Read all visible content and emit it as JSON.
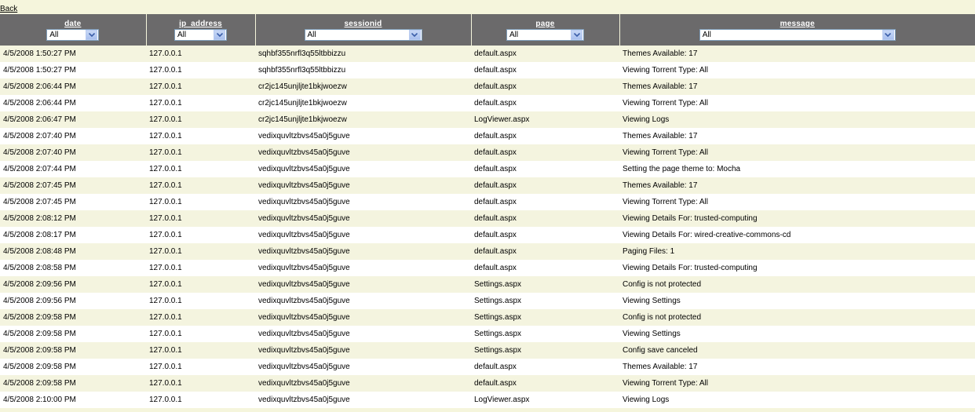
{
  "back_label": "Back",
  "columns": [
    {
      "title": "date",
      "filter": "All"
    },
    {
      "title": "ip_address",
      "filter": "All"
    },
    {
      "title": "sessionid",
      "filter": "All"
    },
    {
      "title": "page",
      "filter": "All"
    },
    {
      "title": "message",
      "filter": "All"
    }
  ],
  "rows": [
    [
      "4/5/2008 1:50:27 PM",
      "127.0.0.1",
      "sqhbf355nrfl3q55ltbbizzu",
      "default.aspx",
      "Themes Available: 17"
    ],
    [
      "4/5/2008 1:50:27 PM",
      "127.0.0.1",
      "sqhbf355nrfl3q55ltbbizzu",
      "default.aspx",
      "Viewing Torrent Type: All"
    ],
    [
      "4/5/2008 2:06:44 PM",
      "127.0.0.1",
      "cr2jc145unjljte1bkjwoezw",
      "default.aspx",
      "Themes Available: 17"
    ],
    [
      "4/5/2008 2:06:44 PM",
      "127.0.0.1",
      "cr2jc145unjljte1bkjwoezw",
      "default.aspx",
      "Viewing Torrent Type: All"
    ],
    [
      "4/5/2008 2:06:47 PM",
      "127.0.0.1",
      "cr2jc145unjljte1bkjwoezw",
      "LogViewer.aspx",
      "Viewing Logs"
    ],
    [
      "4/5/2008 2:07:40 PM",
      "127.0.0.1",
      "vedixquvltzbvs45a0j5guve",
      "default.aspx",
      "Themes Available: 17"
    ],
    [
      "4/5/2008 2:07:40 PM",
      "127.0.0.1",
      "vedixquvltzbvs45a0j5guve",
      "default.aspx",
      "Viewing Torrent Type: All"
    ],
    [
      "4/5/2008 2:07:44 PM",
      "127.0.0.1",
      "vedixquvltzbvs45a0j5guve",
      "default.aspx",
      "Setting the page theme to: Mocha"
    ],
    [
      "4/5/2008 2:07:45 PM",
      "127.0.0.1",
      "vedixquvltzbvs45a0j5guve",
      "default.aspx",
      "Themes Available: 17"
    ],
    [
      "4/5/2008 2:07:45 PM",
      "127.0.0.1",
      "vedixquvltzbvs45a0j5guve",
      "default.aspx",
      "Viewing Torrent Type: All"
    ],
    [
      "4/5/2008 2:08:12 PM",
      "127.0.0.1",
      "vedixquvltzbvs45a0j5guve",
      "default.aspx",
      "Viewing Details For: trusted-computing"
    ],
    [
      "4/5/2008 2:08:17 PM",
      "127.0.0.1",
      "vedixquvltzbvs45a0j5guve",
      "default.aspx",
      "Viewing Details For: wired-creative-commons-cd"
    ],
    [
      "4/5/2008 2:08:48 PM",
      "127.0.0.1",
      "vedixquvltzbvs45a0j5guve",
      "default.aspx",
      "Paging Files: 1"
    ],
    [
      "4/5/2008 2:08:58 PM",
      "127.0.0.1",
      "vedixquvltzbvs45a0j5guve",
      "default.aspx",
      "Viewing Details For: trusted-computing"
    ],
    [
      "4/5/2008 2:09:56 PM",
      "127.0.0.1",
      "vedixquvltzbvs45a0j5guve",
      "Settings.aspx",
      "Config is not protected"
    ],
    [
      "4/5/2008 2:09:56 PM",
      "127.0.0.1",
      "vedixquvltzbvs45a0j5guve",
      "Settings.aspx",
      "Viewing Settings"
    ],
    [
      "4/5/2008 2:09:58 PM",
      "127.0.0.1",
      "vedixquvltzbvs45a0j5guve",
      "Settings.aspx",
      "Config is not protected"
    ],
    [
      "4/5/2008 2:09:58 PM",
      "127.0.0.1",
      "vedixquvltzbvs45a0j5guve",
      "Settings.aspx",
      "Viewing Settings"
    ],
    [
      "4/5/2008 2:09:58 PM",
      "127.0.0.1",
      "vedixquvltzbvs45a0j5guve",
      "Settings.aspx",
      "Config save canceled"
    ],
    [
      "4/5/2008 2:09:58 PM",
      "127.0.0.1",
      "vedixquvltzbvs45a0j5guve",
      "default.aspx",
      "Themes Available: 17"
    ],
    [
      "4/5/2008 2:09:58 PM",
      "127.0.0.1",
      "vedixquvltzbvs45a0j5guve",
      "default.aspx",
      "Viewing Torrent Type: All"
    ],
    [
      "4/5/2008 2:10:00 PM",
      "127.0.0.1",
      "vedixquvltzbvs45a0j5guve",
      "LogViewer.aspx",
      "Viewing Logs"
    ]
  ],
  "icons": {
    "dropdown": "chevron-down-icon"
  },
  "colors": {
    "header_bg": "#6b6a6b",
    "page_bg": "#f5f5dc",
    "row_alt": "#f4f4df",
    "select_border": "#7f9db9"
  }
}
